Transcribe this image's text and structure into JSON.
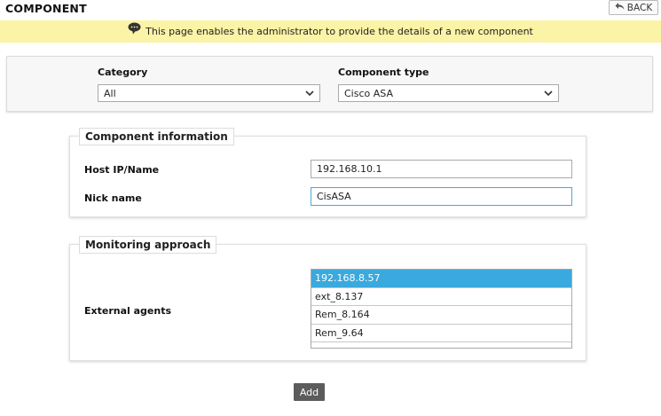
{
  "header": {
    "title": "COMPONENT",
    "back_label": "BACK"
  },
  "info": {
    "message": "This page enables the administrator to provide the details of a new component"
  },
  "selection": {
    "category_label": "Category",
    "category_value": "All",
    "component_type_label": "Component type",
    "component_type_value": "Cisco ASA"
  },
  "component_information": {
    "legend": "Component information",
    "host_label": "Host IP/Name",
    "host_value": "192.168.10.1",
    "nick_label": "Nick name",
    "nick_value": "CisASA"
  },
  "monitoring_approach": {
    "legend": "Monitoring approach",
    "agents_label": "External agents",
    "agents": [
      {
        "name": "192.168.8.57",
        "selected": true
      },
      {
        "name": "ext_8.137",
        "selected": false
      },
      {
        "name": "Rem_8.164",
        "selected": false
      },
      {
        "name": "Rem_9.64",
        "selected": false
      }
    ]
  },
  "actions": {
    "add_label": "Add"
  },
  "colors": {
    "info_bar_bg": "#fbf3a6",
    "selected_item_bg": "#3aa9dd",
    "add_button_bg": "#5c5c5c",
    "focus_border": "#4aa8d8"
  },
  "icons": {
    "back": "undo-arrow-icon",
    "info": "speech-bubble-icon",
    "dropdown": "chevron-down-icon"
  }
}
